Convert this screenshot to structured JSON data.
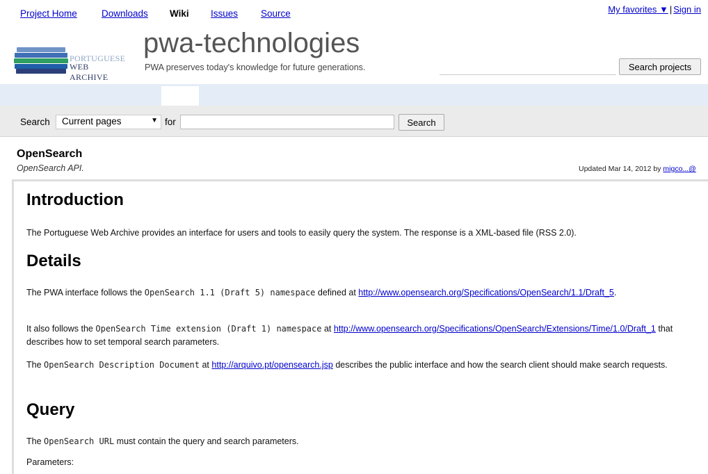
{
  "topbar": {
    "favorites": "My favorites",
    "favorites_arrow": "▼",
    "separator": "|",
    "sign_in": "Sign in"
  },
  "header": {
    "logo_line1": "PORTUGUESE",
    "logo_line2": "WEB ARCHIVE",
    "project_name": "pwa-technologies",
    "project_summary": "PWA preserves today's knowledge for future generations.",
    "search_button": "Search projects"
  },
  "tabs": [
    {
      "label": "Project Home"
    },
    {
      "label": "Downloads"
    },
    {
      "label": "Wiki"
    },
    {
      "label": "Issues"
    },
    {
      "label": "Source"
    }
  ],
  "wiki_search": {
    "label": "Search",
    "scope_selected": "Current pages",
    "for_label": "for",
    "button": "Search"
  },
  "page": {
    "title": "OpenSearch",
    "summary": "OpenSearch API.",
    "updated_prefix": "Updated Mar 14, 2012 by",
    "updated_user": "migco...@"
  },
  "content": {
    "intro_heading": "Introduction",
    "intro_text": "The Portuguese Web Archive provides an interface for users and tools to easily query the system. The response is a XML-based file (RSS 2.0).",
    "details_heading": "Details",
    "details_p1_a": "The PWA interface follows the",
    "details_p1_code": "OpenSearch 1.1 (Draft 5) namespace",
    "details_p1_b": "defined at",
    "details_p1_link": "http://www.opensearch.org/Specifications/OpenSearch/1.1/Draft_5",
    "details_p1_end": ".",
    "details_p2_a": "It also follows the",
    "details_p2_code": "OpenSearch Time extension (Draft 1) namespace",
    "details_p2_b": "at",
    "details_p2_link": "http://www.opensearch.org/Specifications/OpenSearch/Extensions/Time/1.0/Draft_1",
    "details_p2_c": "that describes how to set temporal search parameters.",
    "details_p3_a": "The",
    "details_p3_code": "OpenSearch Description Document",
    "details_p3_b": "at",
    "details_p3_link": "http://arquivo.pt/opensearch.jsp",
    "details_p3_c": "describes the public interface and how the search client should make search requests.",
    "query_heading": "Query",
    "query_p1_a": "The",
    "query_p1_code": "OpenSearch URL",
    "query_p1_b": "must contain the query and search parameters.",
    "parameters_label": "Parameters:"
  },
  "colors": {
    "link": "#0000cc",
    "tab_bar": "#e4ecf7",
    "search_bar": "#ebebeb"
  }
}
